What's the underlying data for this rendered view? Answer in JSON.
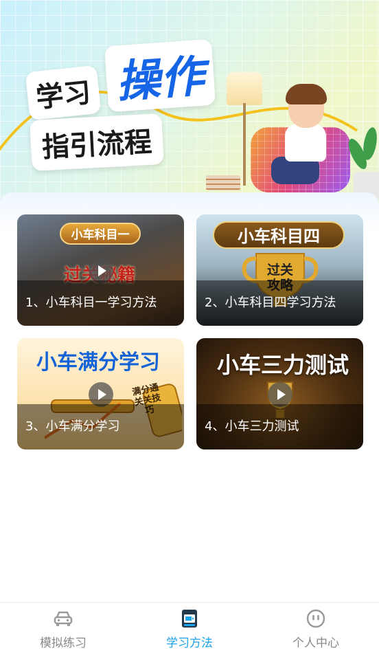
{
  "hero": {
    "title_line1": "学习",
    "title_highlight": "操作",
    "title_line2": "指引流程"
  },
  "cards": [
    {
      "caption": "1、小车科目一学习方法",
      "badge": "小车科目一",
      "art_text": "过关秘籍"
    },
    {
      "caption": "2、小车科目四学习方法",
      "badge": "小车科目四",
      "art_text": "过关攻略"
    },
    {
      "caption": "3、小车满分学习",
      "badge": "小车满分学习",
      "art_text": "满分通关关技巧"
    },
    {
      "caption": "4、小车三力测试",
      "badge": "小车三力测试",
      "art_text": ""
    }
  ],
  "tabbar": {
    "items": [
      {
        "label": "模拟练习",
        "icon": "car-icon",
        "active": false
      },
      {
        "label": "学习方法",
        "icon": "study-icon",
        "active": true
      },
      {
        "label": "个人中心",
        "icon": "profile-icon",
        "active": false
      }
    ],
    "active_color": "#1aa3e8",
    "inactive_color": "#888888"
  }
}
